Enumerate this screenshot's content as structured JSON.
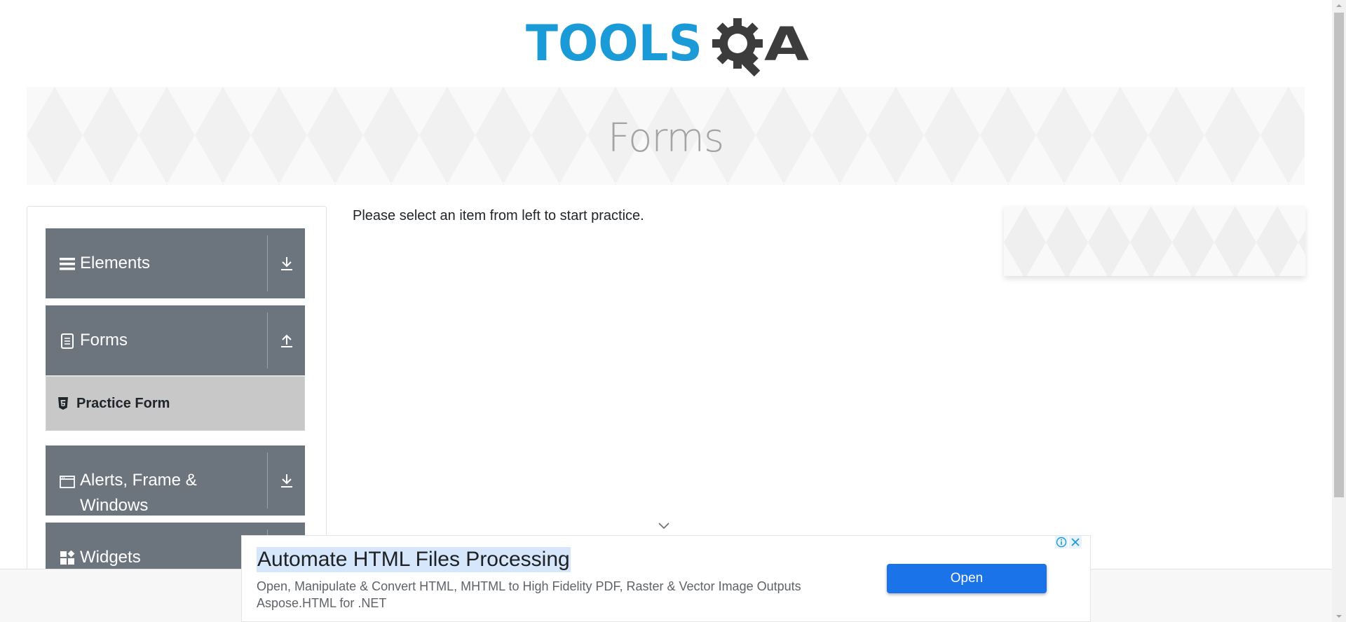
{
  "logo": {
    "text_part": "TOOLS",
    "text_part2": "QA"
  },
  "banner": {
    "title": "Forms"
  },
  "sidebar": {
    "groups": [
      {
        "title": "Elements",
        "icon": "hamburger-icon",
        "toggle": "download-arrow-icon"
      },
      {
        "title": "Forms",
        "icon": "document-icon",
        "toggle": "upload-arrow-icon"
      },
      {
        "title": "Alerts, Frame & Windows",
        "icon": "browser-window-icon",
        "toggle": "download-arrow-icon"
      },
      {
        "title": "Widgets",
        "icon": "widgets-icon",
        "toggle": "download-arrow-icon"
      }
    ],
    "forms_items": [
      {
        "label": "Practice Form",
        "icon": "html5-icon"
      }
    ]
  },
  "main": {
    "message": "Please select an item from left to start practice."
  },
  "ad": {
    "title": "Automate HTML Files Processing",
    "description": "Open, Manipulate & Convert HTML, MHTML to High Fidelity PDF, Raster & Vector Image Outputs",
    "sponsor": "Aspose.HTML for .NET",
    "button": "Open"
  },
  "colors": {
    "brand_blue": "#1a9bd7",
    "brand_dark": "#3c3c3c",
    "sidebar_bg": "#6c757d",
    "ad_button": "#1a73e8"
  }
}
